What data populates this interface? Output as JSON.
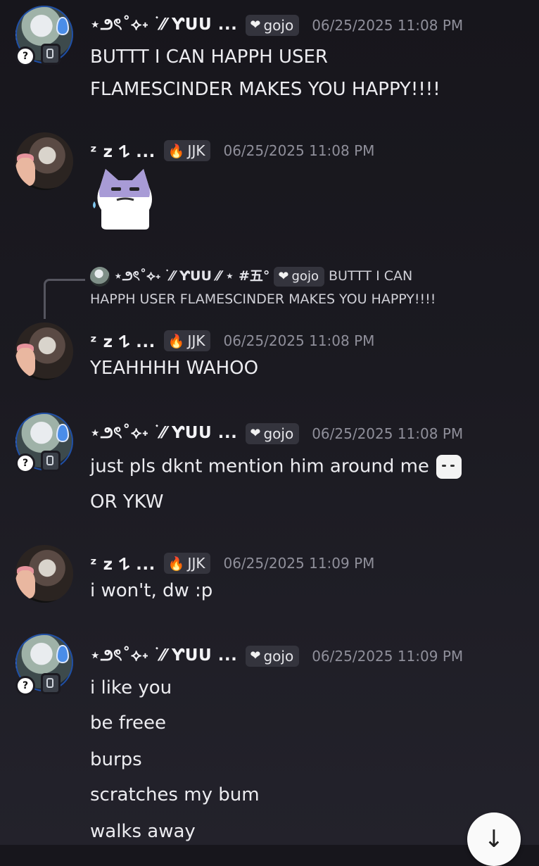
{
  "users": {
    "yuu": {
      "name": "⋆౨ৎ˚⟡˖ ࣪ ⁄⁄ ƳUU ...",
      "tag": "gojo",
      "tag_icon": "heart-icon"
    },
    "z": {
      "name": "ᶻ z 𐰁 ...",
      "tag": "JJK",
      "tag_icon": "fire-icon"
    }
  },
  "messages": [
    {
      "author": "yuu",
      "timestamp": "06/25/2025 11:08 PM",
      "lines": [
        "BUTTT I CAN HAPPH USER",
        "FLAMESCINDER MAKES YOU HAPPY!!!!"
      ]
    },
    {
      "author": "z",
      "timestamp": "06/25/2025 11:08 PM",
      "lines": [],
      "attachment": "cat-sticker"
    },
    {
      "author": "z",
      "timestamp": "06/25/2025 11:08 PM",
      "lines": [
        "YEAHHHH WAHOO"
      ],
      "reply_to": {
        "name": "⋆౨ৎ˚⟡˖ ࣪ ⁄⁄ ƳUU ⁄⁄ ⋆ #五°",
        "tag": "gojo",
        "text_1": "BUTTT I CAN",
        "text_2": "HAPPH USER FLAMESCINDER MAKES YOU HAPPY!!!!"
      }
    },
    {
      "author": "yuu",
      "timestamp": "06/25/2025 11:08 PM",
      "lines": [
        "just pls dknt mention him around me",
        "OR YKW"
      ]
    },
    {
      "author": "z",
      "timestamp": "06/25/2025 11:09 PM",
      "lines": [
        "i won't, dw :p"
      ]
    },
    {
      "author": "yuu",
      "timestamp": "06/25/2025 11:09 PM",
      "lines": [
        "i like you",
        "be freee",
        "burps",
        "scratches my bum",
        "walks away"
      ]
    }
  ],
  "badges": {
    "unknown": "?"
  },
  "scroll_button": {
    "icon": "arrow-down-icon",
    "glyph": "↓"
  }
}
